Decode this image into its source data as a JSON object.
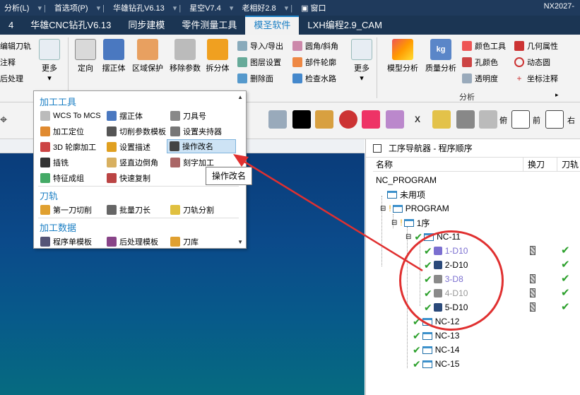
{
  "menubar": {
    "items": [
      "分析(L)",
      "首选项(P)",
      "华雄钻孔V6.13",
      "星空V7.4",
      "老相好2.8",
      "窗口"
    ],
    "right_text": "NX2027-"
  },
  "tabs": [
    "4",
    "华雄CNC钻孔V6.13",
    "同步建模",
    "零件测量工具",
    "模圣软件",
    "LXH编程2.9_CAM"
  ],
  "active_tab": "模圣软件",
  "ribbon": {
    "left_partial": [
      "编辑刀轨",
      "注释",
      "后处理"
    ],
    "more_label": "更多",
    "large_buttons": [
      "定向",
      "摆正体",
      "区域保护",
      "移除参数",
      "拆分体"
    ],
    "small_col1": [
      "导入/导出",
      "图层设置",
      "删除面"
    ],
    "small_col2": [
      "圆角/斜角",
      "部件轮廓",
      "检查水路"
    ],
    "more2_label": "更多",
    "large_buttons2": [
      "模型分析",
      "质量分析"
    ],
    "small_col3": [
      "颜色工具",
      "孔颜色",
      "透明度"
    ],
    "small_col4": [
      "几何属性",
      "动态圆",
      "坐标注释"
    ],
    "group_label": "分析"
  },
  "toolbar2": {
    "labels": [
      "俯",
      "前",
      "右"
    ]
  },
  "dropdown": {
    "sections": [
      {
        "title": "加工工具",
        "items": [
          "WCS To MCS",
          "摆正体",
          "刀具号",
          "加工定位",
          "切削参数模板",
          "设置夹持器",
          "3D 轮廓加工",
          "设置描述",
          "操作改名",
          "插铣",
          "竖直边倒角",
          "刻字加工",
          "特征成组",
          "快速复制"
        ]
      },
      {
        "title": "刀轨",
        "items": [
          "第一刀切削",
          "批量刀长",
          "刀轨分割"
        ]
      },
      {
        "title": "加工数据",
        "items": [
          "程序单模板",
          "后处理模板",
          "刀库"
        ]
      }
    ],
    "highlighted": "操作改名",
    "tooltip": "操作改名"
  },
  "navigator": {
    "title": "工序导航器 - 程序顺序",
    "columns": [
      "名称",
      "换刀",
      "刀轨"
    ],
    "rows": [
      {
        "name": "NC_PROGRAM",
        "level": 0
      },
      {
        "name": "未用项",
        "level": 1
      },
      {
        "name": "PROGRAM",
        "level": 1
      },
      {
        "name": "1序",
        "level": 2
      },
      {
        "name": "NC-11",
        "level": 3
      },
      {
        "name": "1-D10",
        "level": 4
      },
      {
        "name": "2-D10",
        "level": 4
      },
      {
        "name": "3-D8",
        "level": 4
      },
      {
        "name": "4-D10",
        "level": 4
      },
      {
        "name": "5-D10",
        "level": 4
      },
      {
        "name": "NC-12",
        "level": 3
      },
      {
        "name": "NC-13",
        "level": 3
      },
      {
        "name": "NC-14",
        "level": 3
      },
      {
        "name": "NC-15",
        "level": 3
      }
    ]
  },
  "colors": {
    "title_bar": "#1f3a5c",
    "accent": "#1b7fc4",
    "check": "#2ca02c",
    "annotation": "#e03030",
    "viewport": "#0b4a8a"
  }
}
